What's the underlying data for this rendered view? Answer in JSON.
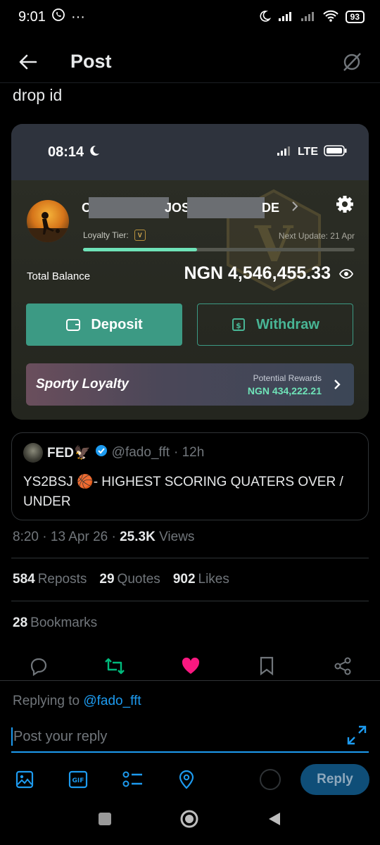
{
  "status_bar": {
    "time": "9:01",
    "dots": "···",
    "battery": "93"
  },
  "header": {
    "title": "Post"
  },
  "post": {
    "text": "drop id"
  },
  "embedded": {
    "time": "08:14",
    "network": "LTE",
    "name_fragments": [
      "O",
      "JOS",
      "DE"
    ],
    "loyalty_tier_label": "Loyalty Tier:",
    "tier_badge": "V",
    "next_update": "Next Update: 21 Apr",
    "progress_fraction": 0.42,
    "total_label": "Total Balance",
    "total_value": "NGN 4,546,455.33",
    "deposit_label": "Deposit",
    "withdraw_label": "Withdraw",
    "loyalty_title": "Sporty Loyalty",
    "rewards_label": "Potential Rewards",
    "rewards_value": "NGN 434,222.21"
  },
  "quote": {
    "name": "FED🦅",
    "handle": "@fado_fft",
    "time": "· 12h",
    "text": "YS2BSJ 🏀- HIGHEST SCORING QUATERS OVER / UNDER"
  },
  "meta": {
    "time": "8:20",
    "date": "13 Apr 26",
    "views_count": "25.3K",
    "views_label": "Views",
    "sep": " · "
  },
  "stats": {
    "reposts_count": "584",
    "reposts_label": "Reposts",
    "quotes_count": "29",
    "quotes_label": "Quotes",
    "likes_count": "902",
    "likes_label": "Likes",
    "bookmarks_count": "28",
    "bookmarks_label": "Bookmarks"
  },
  "reply": {
    "replying_prefix": "Replying to",
    "replying_handle": "@fado_fft",
    "placeholder": "Post your reply",
    "button": "Reply"
  },
  "colors": {
    "accent": "#1d9bf0",
    "like": "#f91880",
    "repost": "#00ba7c",
    "sporty_green": "#3c9a84"
  }
}
